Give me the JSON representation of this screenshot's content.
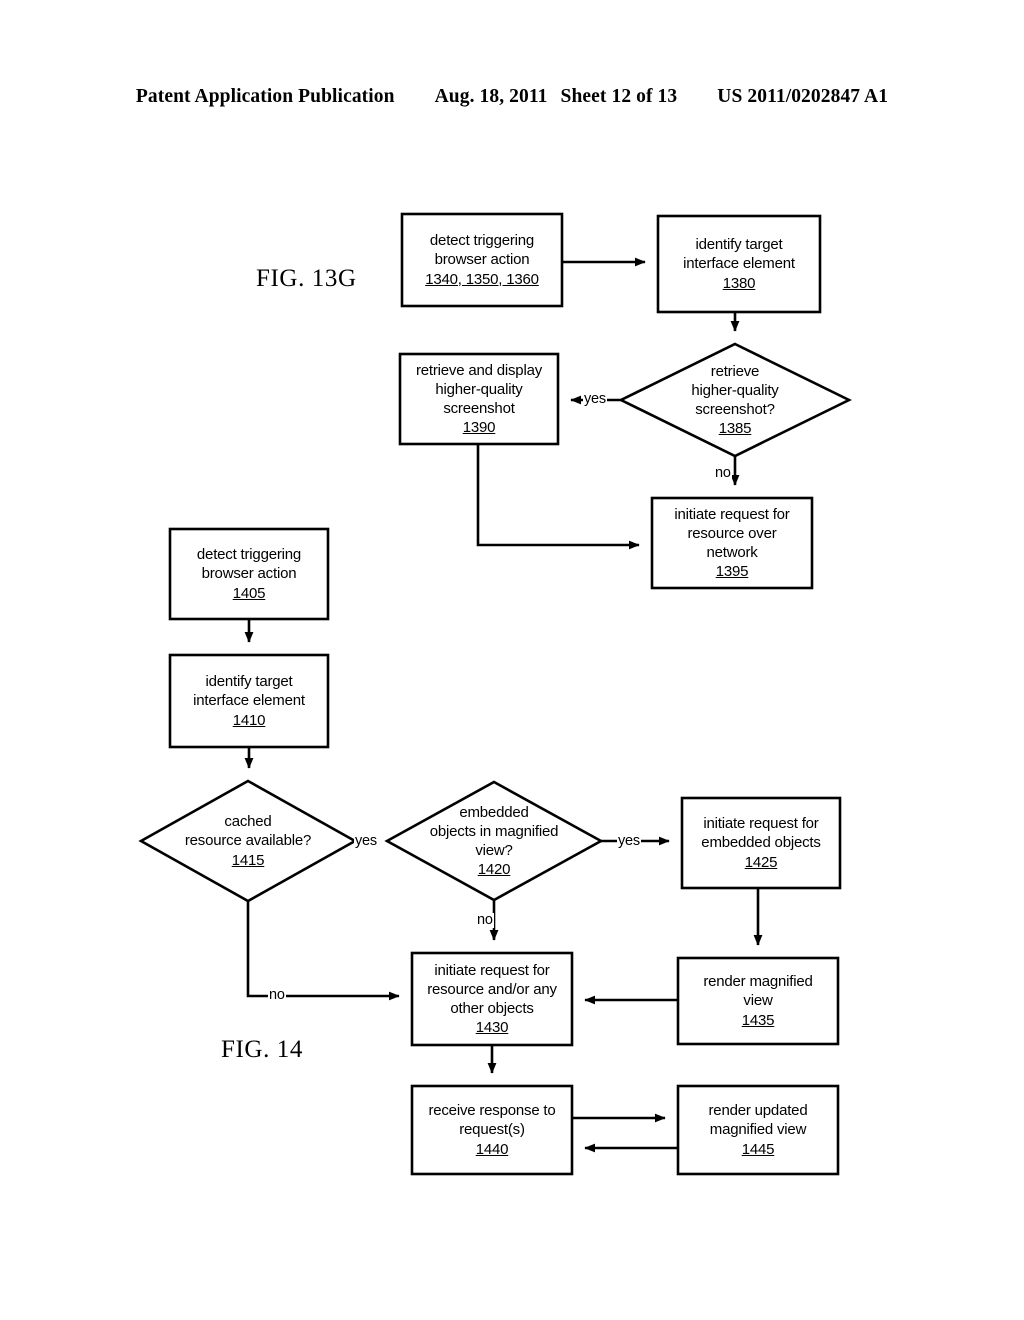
{
  "header": {
    "publication": "Patent Application Publication",
    "date": "Aug. 18, 2011",
    "sheet": "Sheet 12 of 13",
    "patent_number": "US 2011/0202847 A1"
  },
  "captions": {
    "fig_13g": "FIG. 13G",
    "fig_14": "FIG. 14"
  },
  "figure_13g": {
    "nodes": {
      "detect_trigger": {
        "line1": "detect triggering",
        "line2": "browser action",
        "ref": "1340, 1350, 1360"
      },
      "identify_target": {
        "line1": "identify target",
        "line2": "interface element",
        "ref": "1380"
      },
      "retrieve_decision": {
        "line1": "retrieve",
        "line2": "higher-quality",
        "line3": "screenshot?",
        "ref": "1385"
      },
      "retrieve_display": {
        "line1": "retrieve and display",
        "line2": "higher-quality",
        "line3": "screenshot",
        "ref": "1390"
      },
      "initiate_network": {
        "line1": "initiate request for",
        "line2": "resource over",
        "line3": "network",
        "ref": "1395"
      }
    },
    "edge_labels": {
      "yes_to_1390": "yes",
      "no_to_1395": "no"
    }
  },
  "figure_14": {
    "nodes": {
      "detect_trigger": {
        "line1": "detect triggering",
        "line2": "browser action",
        "ref": "1405"
      },
      "identify_target": {
        "line1": "identify target",
        "line2": "interface element",
        "ref": "1410"
      },
      "cached_decision": {
        "line1": "cached",
        "line2": "resource available?",
        "ref": "1415"
      },
      "embedded_decision": {
        "line1": "embedded",
        "line2": "objects in magnified",
        "line3": "view?",
        "ref": "1420"
      },
      "request_embedded": {
        "line1": "initiate request for",
        "line2": "embedded objects",
        "ref": "1425"
      },
      "request_resource": {
        "line1": "initiate request for",
        "line2": "resource and/or any",
        "line3": "other objects",
        "ref": "1430"
      },
      "render_magnified": {
        "line1": "render magnified",
        "line2": "view",
        "ref": "1435"
      },
      "receive_response": {
        "line1": "receive response to",
        "line2": "request(s)",
        "ref": "1440"
      },
      "render_updated": {
        "line1": "render updated",
        "line2": "magnified view",
        "ref": "1445"
      }
    },
    "edge_labels": {
      "yes_1415_to_1420": "yes",
      "yes_1420_to_1425": "yes",
      "no_1420_to_1430": "no",
      "no_1415_to_1430": "no"
    }
  },
  "colors": {
    "ink": "#000000",
    "paper": "#ffffff"
  }
}
